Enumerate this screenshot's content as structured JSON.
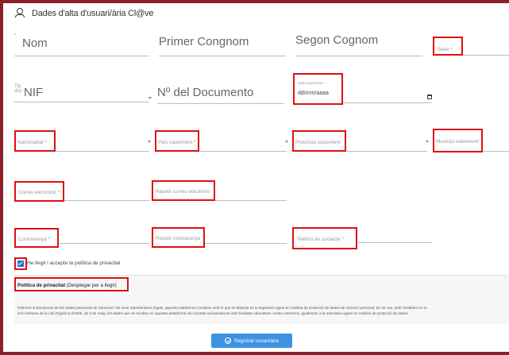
{
  "header": {
    "title": "Dades d'alta d'usuari/ària Cl@ve",
    "icon": "user-icon"
  },
  "row1": {
    "nom_prefix": "*",
    "nom": "Nom",
    "primer_cognom": "Primer Congnom",
    "segon_cognom": "Segon Cognom",
    "sexe": "Sexe *"
  },
  "row2": {
    "doc_type_prefix": "Tip\ndoc",
    "nif": "NIF",
    "num_document": "Nº del Documento",
    "data_naixement_label": "Data naixement *",
    "data_naixement_value": "dd/mm/aaaa"
  },
  "row3": {
    "nacionalitat": "Nacionalitat *",
    "pais_naixement": "País naixement *",
    "provincia_naixement": "Provincia naixement",
    "municipi_naixement": "Municipi naixement"
  },
  "row4": {
    "correu": "Correu electrònic *",
    "repetir_correu": "Repetir correu electrònic"
  },
  "row5": {
    "contrasenya": "Contrasenya *",
    "repetir_contrasenya": "Repetir contrasenya",
    "telefon": "Telefon de contacte *"
  },
  "terms": {
    "checked": true,
    "label": "He llegit i accepte la política de privacitat"
  },
  "policy": {
    "title_bold": "Política de privacitat",
    "title_rest": " (Desplegar per a llegir)",
    "text_line1": "Referent al tractament de les dades personals de l'alumnat i els seus representants legals, aquesta plataforma compleix amb el que es disposa en la legislació vigent en matèria de protecció de dades de caràcter personal. En tot cas, amb l'establert en la",
    "text_line2": "vint-i-tresena de la Llei Orgànica 2/2006, de 3 de maig, les dades que es recullen en aquesta plataforma són tractats exclusivament amb finalitats educatives i estan sotmesos, igualment, a la normativa vigent en matèria de protecció de dades."
  },
  "submit": {
    "label": "Registrar usuari/ària"
  },
  "colors": {
    "frame": "#8b1f2b",
    "highlight": "#e01010",
    "accent": "#3d93e0"
  }
}
